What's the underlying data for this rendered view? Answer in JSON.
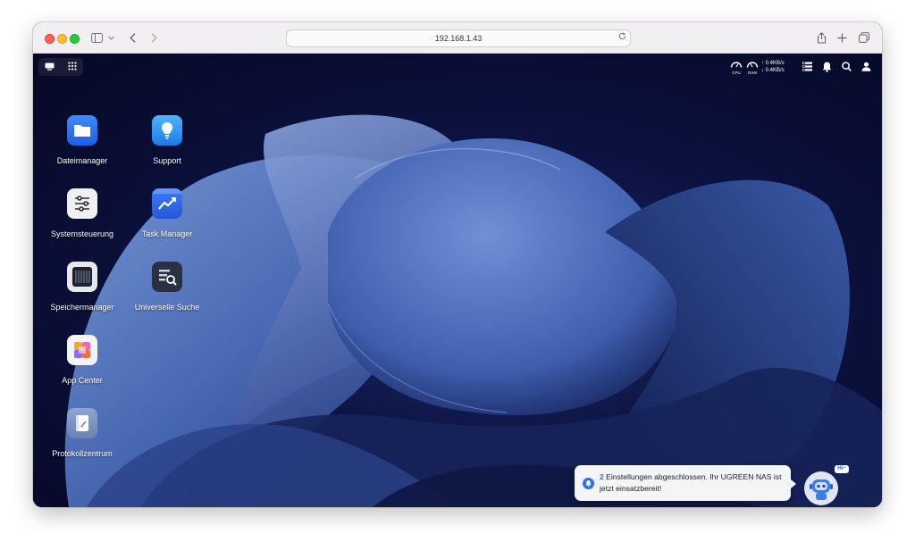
{
  "browser": {
    "url": "192.168.1.43",
    "icons": [
      "sidebar-icon",
      "chevron-down-icon",
      "back-icon",
      "forward-icon",
      "reload-icon",
      "share-icon",
      "new-tab-icon",
      "tabs-overview-icon"
    ]
  },
  "topbar": {
    "cpu_label": "CPU",
    "ram_label": "RAM",
    "upload_rate": "0.4KB/s",
    "download_rate": "0.4KB/s",
    "upload_arrow": "↑",
    "download_arrow": "↓"
  },
  "apps": [
    {
      "label": "Dateimanager",
      "icon": "folder-icon"
    },
    {
      "label": "Support",
      "icon": "lightbulb-icon"
    },
    {
      "label": "Systemsteuerung",
      "icon": "sliders-icon"
    },
    {
      "label": "Task Manager",
      "icon": "chart-icon"
    },
    {
      "label": "Speichermanager",
      "icon": "storage-icon"
    },
    {
      "label": "Universelle Suche",
      "icon": "search-doc-icon"
    },
    {
      "label": "App Center",
      "icon": "app-center-icon"
    },
    {
      "label": "Protokollzentrum",
      "icon": "log-icon"
    }
  ],
  "notification": {
    "count": "2",
    "text": " Einstellungen abgeschlossen. Ihr UGREEN NAS ist jetzt einsatzbereit!"
  },
  "assistant": {
    "greeting": "Hi~"
  },
  "colors": {
    "accent": "#2f6cf5",
    "desktop_dark": "#060824",
    "wallpaper_blue": "#4a6cb8"
  }
}
